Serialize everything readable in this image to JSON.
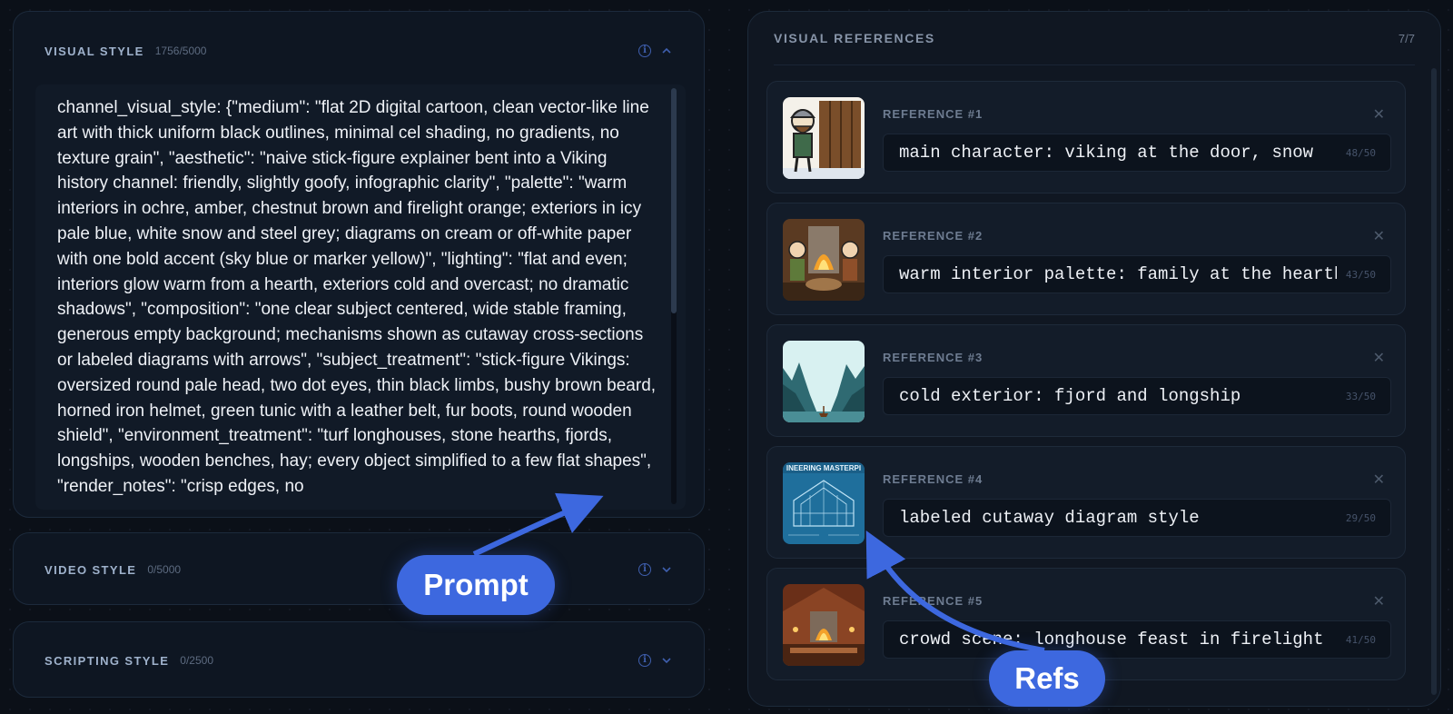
{
  "left": {
    "visual_style": {
      "title": "VISUAL STYLE",
      "count": "1756/5000",
      "text": "channel_visual_style: {\"medium\": \"flat 2D digital cartoon, clean vector-like line art with thick uniform black outlines, minimal cel shading, no gradients, no texture grain\", \"aesthetic\": \"naive stick-figure explainer bent into a Viking history channel: friendly, slightly goofy, infographic clarity\", \"palette\": \"warm interiors in ochre, amber, chestnut brown and firelight orange; exteriors in icy pale blue, white snow and steel grey; diagrams on cream or off-white paper with one bold accent (sky blue or marker yellow)\", \"lighting\": \"flat and even; interiors glow warm from a hearth, exteriors cold and overcast; no dramatic shadows\", \"composition\": \"one clear subject centered, wide stable framing, generous empty background; mechanisms shown as cutaway cross-sections or labeled diagrams with arrows\", \"subject_treatment\": \"stick-figure Vikings: oversized round pale head, two dot eyes, thin black limbs, bushy brown beard, horned iron helmet, green tunic with a leather belt, fur boots, round wooden shield\", \"environment_treatment\": \"turf longhouses, stone hearths, fjords, longships, wooden benches, hay; every object simplified to a few flat shapes\", \"render_notes\": \"crisp edges, no"
    },
    "video_style": {
      "title": "VIDEO STYLE",
      "count": "0/5000"
    },
    "scripting_style": {
      "title": "SCRIPTING STYLE",
      "count": "0/2500"
    }
  },
  "right": {
    "title": "VISUAL REFERENCES",
    "count": "7/7",
    "references": [
      {
        "label": "REFERENCE #1",
        "text": "main character: viking at the door, snow",
        "count": "48/50",
        "thumb": "viking-door-thumbnail"
      },
      {
        "label": "REFERENCE #2",
        "text": "warm interior palette: family at the hearth",
        "count": "43/50",
        "thumb": "family-hearth-thumbnail"
      },
      {
        "label": "REFERENCE #3",
        "text": "cold exterior: fjord and longship",
        "count": "33/50",
        "thumb": "fjord-longship-thumbnail"
      },
      {
        "label": "REFERENCE #4",
        "text": "labeled cutaway diagram style",
        "count": "29/50",
        "thumb": "blueprint-diagram-thumbnail",
        "thumb_caption": "INEERING MASTERPI"
      },
      {
        "label": "REFERENCE #5",
        "text": "crowd scene: longhouse feast in firelight",
        "count": "41/50",
        "thumb": "longhouse-feast-thumbnail"
      }
    ]
  },
  "callouts": {
    "prompt": "Prompt",
    "refs": "Refs"
  },
  "colors": {
    "accent": "#3d68df",
    "panel": "#0e1622",
    "background": "#0b1018"
  }
}
